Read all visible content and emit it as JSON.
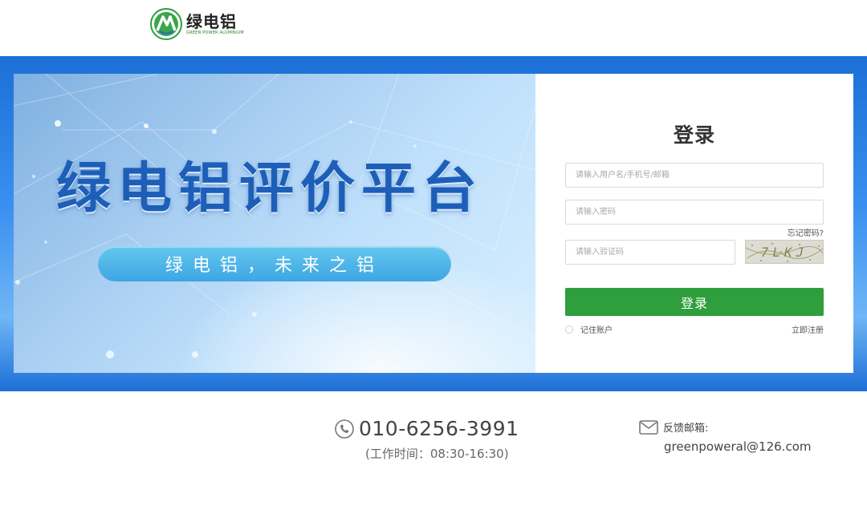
{
  "header": {
    "logo_cn": "绿电铝",
    "logo_en": "GREEN POWER ALUMINIUM"
  },
  "banner": {
    "title": "绿电铝评价平台",
    "slogan": "绿电铝，未来之铝"
  },
  "login": {
    "title": "登录",
    "username_placeholder": "请输入用户名/手机号/邮箱",
    "password_placeholder": "请输入密码",
    "forgot_label": "忘记密码?",
    "captcha_placeholder": "请输入验证码",
    "captcha_text": "7LKJ",
    "submit_label": "登录",
    "remember_label": "记住账户",
    "register_label": "立即注册"
  },
  "footer": {
    "phone": "010-6256-3991",
    "work_hours": "(工作时间：08:30-16:30)",
    "email_label": "反馈邮箱:",
    "email": "greenpoweral@126.com"
  },
  "colors": {
    "accent_green": "#2f9e3d",
    "band_blue": "#1c6fd6",
    "title_blue": "#1d5fb8"
  },
  "icons": [
    "logo-mark-icon",
    "phone-icon",
    "mail-icon"
  ]
}
